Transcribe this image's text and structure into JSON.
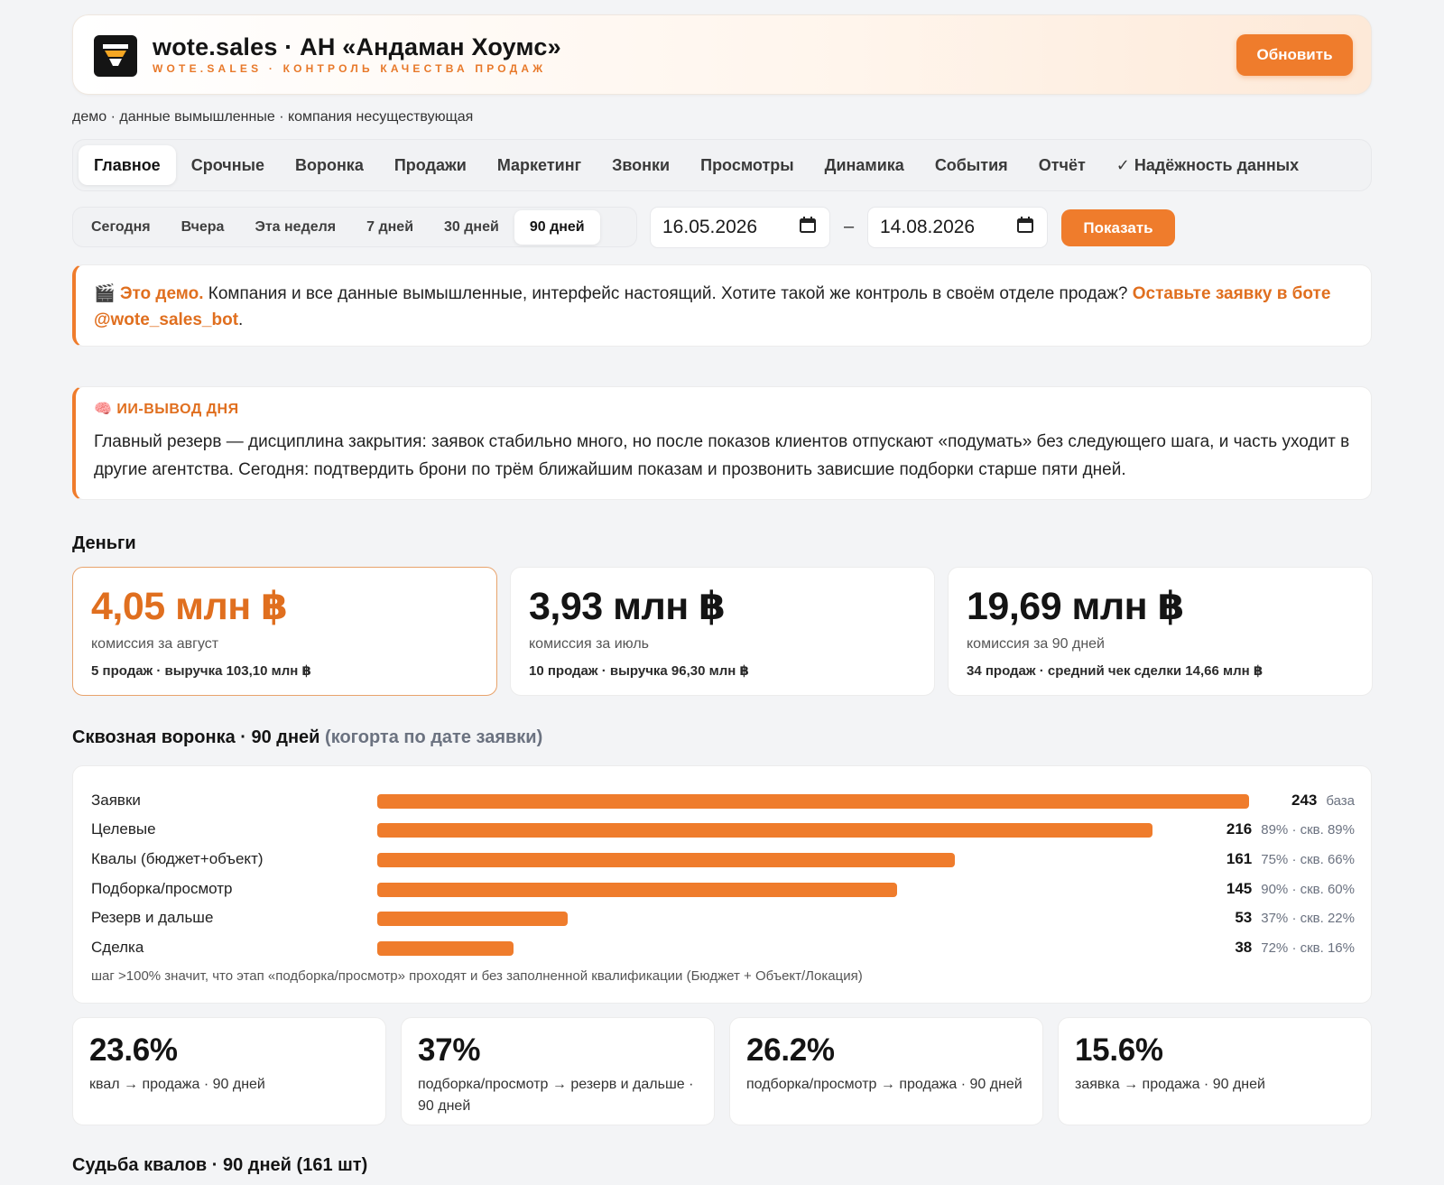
{
  "header": {
    "title": "wote.sales · АН «Андаман Хоумс»",
    "subtitle": "WOTE.SALES · КОНТРОЛЬ КАЧЕСТВА ПРОДАЖ",
    "refresh_label": "Обновить",
    "logo_icon": "funnel-logo-icon",
    "accent_color": "#ef7c2c"
  },
  "demo_note": "демо · данные вымышленные · компания несуществующая",
  "nav": {
    "tabs": [
      {
        "label": "Главное",
        "active": true
      },
      {
        "label": "Срочные"
      },
      {
        "label": "Воронка"
      },
      {
        "label": "Продажи"
      },
      {
        "label": "Маркетинг"
      },
      {
        "label": "Звонки"
      },
      {
        "label": "Просмотры"
      },
      {
        "label": "Динамика"
      },
      {
        "label": "События"
      },
      {
        "label": "Отчёт"
      },
      {
        "label": "✓ Надёжность данных"
      }
    ]
  },
  "period": {
    "options": [
      "Сегодня",
      "Вчера",
      "Эта неделя",
      "7 дней",
      "30 дней",
      "90 дней"
    ],
    "active": "90 дней",
    "date_from": "16.05.2026",
    "date_to": "14.08.2026",
    "dash": "–",
    "show_label": "Показать"
  },
  "demo_callout": {
    "emoji": "🎬",
    "bold": "Это демо.",
    "text": " Компания и все данные вымышленные, интерфейс настоящий. Хотите такой же контроль в своём отделе продаж? ",
    "link": "Оставьте заявку в боте @wote_sales_bot",
    "end": "."
  },
  "ai_callout": {
    "emoji": "🧠",
    "head": "ИИ-ВЫВОД ДНЯ",
    "text": "Главный резерв — дисциплина закрытия: заявок стабильно много, но после показов клиентов отпускают «подумать» без следующего шага, и часть уходит в другие агентства. Сегодня: подтвердить брони по трём ближайшим показам и прозвонить зависшие подборки старше пяти дней."
  },
  "money": {
    "title": "Деньги",
    "cards": [
      {
        "value": "4,05 млн ฿",
        "label": "комиссия за август",
        "sub": "5 продаж · выручка 103,10 млн ฿"
      },
      {
        "value": "3,93 млн ฿",
        "label": "комиссия за июль",
        "sub": "10 продаж · выручка 96,30 млн ฿"
      },
      {
        "value": "19,69 млн ฿",
        "label": "комиссия за 90 дней",
        "sub": "34 продаж · средний чек сделки 14,66 млн ฿"
      }
    ]
  },
  "funnel": {
    "title": "Сквозная воронка · 90 дней",
    "title_muted": "(когорта по дате заявки)",
    "note": "шаг >100% значит, что этап «подборка/просмотр» проходят и без заполненной квалификации (Бюджет + Объект/Локация)",
    "rows": [
      {
        "label": "Заявки",
        "count": 243,
        "count_text": "243",
        "pct": "база"
      },
      {
        "label": "Целевые",
        "count": 216,
        "count_text": "216",
        "pct": "89% · скв. 89%"
      },
      {
        "label": "Квалы (бюджет+объект)",
        "count": 161,
        "count_text": "161",
        "pct": "75% · скв. 66%"
      },
      {
        "label": "Подборка/просмотр",
        "count": 145,
        "count_text": "145",
        "pct": "90% · скв. 60%"
      },
      {
        "label": "Резерв и дальше",
        "count": 53,
        "count_text": "53",
        "pct": "37% · скв. 22%"
      },
      {
        "label": "Сделка",
        "count": 38,
        "count_text": "38",
        "pct": "72% · скв. 16%"
      }
    ]
  },
  "kpis": [
    {
      "value": "23.6%",
      "label": "квал → продажа · 90 дней"
    },
    {
      "value": "37%",
      "label": "подборка/просмотр → резерв и дальше · 90 дней"
    },
    {
      "value": "26.2%",
      "label": "подборка/просмотр → продажа · 90 дней"
    },
    {
      "value": "15.6%",
      "label": "заявка → продажа · 90 дней"
    }
  ],
  "fate": {
    "title": "Судьба квалов · 90 дней (161 шт)"
  }
}
